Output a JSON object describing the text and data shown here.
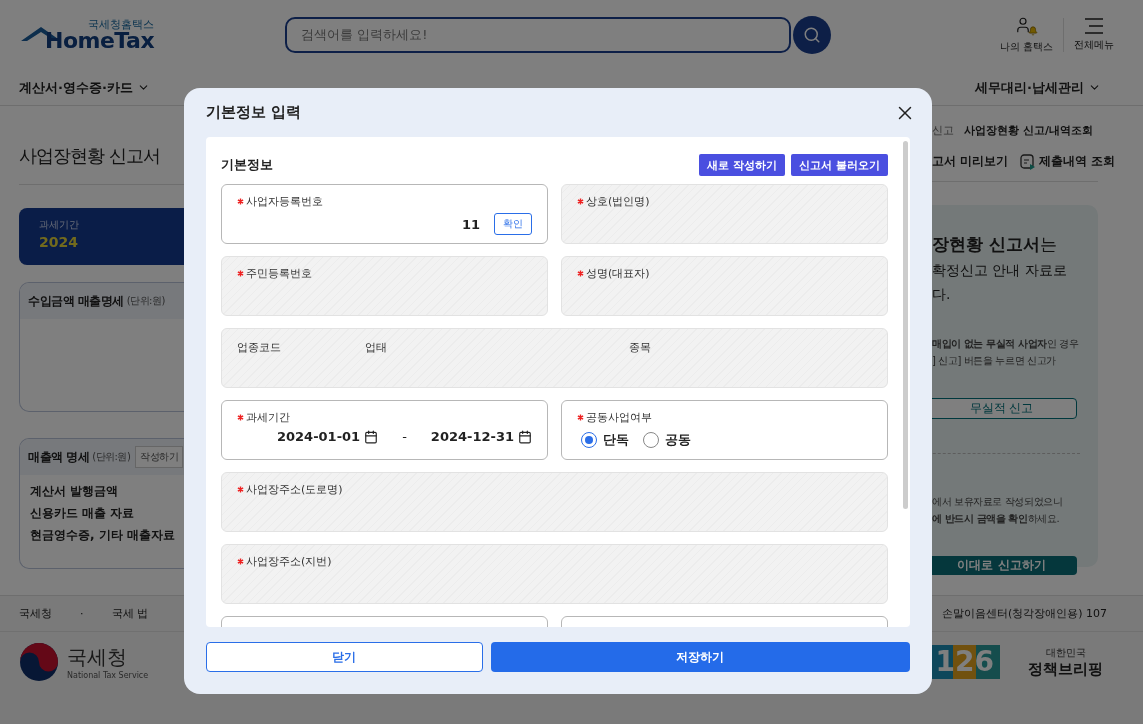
{
  "header": {
    "logo_caption": "국세청홈택스",
    "logo": "HomeTax",
    "search": {
      "placeholder": "검색어를 입력하세요!"
    },
    "links": [
      {
        "label": "나의 홈택스",
        "kind": "user"
      },
      {
        "label": "전체메뉴",
        "kind": "menu"
      }
    ]
  },
  "nav": [
    "계산서·영수증·카드",
    "세무대리·납세관리"
  ],
  "page": {
    "title": "사업장현황 신고서",
    "period": {
      "label": "과세기간",
      "value": "2024"
    },
    "income_card": {
      "title": "수입금액 매출명세",
      "unit": "(단위:원)"
    },
    "sales_card": {
      "title": "매출액 명세",
      "unit": "(단위:원)",
      "button": "작성하기",
      "rows": [
        "계산서 발행금액",
        "신용카드 매출 자료",
        "현금영수증, 기타 매출자료"
      ]
    }
  },
  "breadcrumb": [
    "신고",
    "사업장현황 신고/내역조회"
  ],
  "actions": [
    "고서 미리보기",
    "제출내역 조회"
  ],
  "guide": {
    "headline": "**장현황 신고서**는",
    "lines": [
      "확정신고 안내 자료로",
      "다."
    ],
    "notice": [
      "**매입이 없는 무실적 사업자**인 경우",
      "] 신고] 버튼을 누르면 신고가"
    ],
    "nil_button": "무실적 신고",
    "notice2": [
      "에서 보유자료로 작성되었으니",
      "**에 반드시 금액을 확인**하세요."
    ],
    "submit_button": "이대로 신고하기"
  },
  "footer": {
    "links": [
      "국세청",
      "·",
      "국세 법"
    ],
    "relay": "손말이음센터(청각장애인용) 107",
    "agency": "국세청",
    "agency_en": "National Tax Service",
    "hotline": "126",
    "briefing_caption": "대한민국",
    "briefing": "정책브리핑"
  },
  "modal": {
    "title": "기본정보 입력",
    "section": "기본정보",
    "section_buttons": [
      "새로 작성하기",
      "신고서 불러오기"
    ],
    "fields": [
      {
        "kind": "number",
        "label": "사업자등록번호",
        "required": true,
        "wide": false,
        "value": "11",
        "button": "확인"
      },
      {
        "kind": "readonly",
        "label": "상호(법인명)",
        "required": true,
        "wide": false
      },
      {
        "kind": "readonly",
        "label": "주민등록번호",
        "required": true,
        "wide": false
      },
      {
        "kind": "readonly",
        "label": "성명(대표자)",
        "required": true,
        "wide": false
      },
      {
        "kind": "triple",
        "labels": [
          "업종코드",
          "업태",
          "종목"
        ],
        "wide": true
      },
      {
        "kind": "period",
        "label": "과세기간",
        "required": true,
        "wide": false,
        "start": "2024-01-01",
        "separator": "-",
        "end": "2024-12-31"
      },
      {
        "kind": "radio",
        "label": "공동사업여부",
        "required": true,
        "wide": false,
        "options": [
          {
            "label": "단독",
            "selected": true
          },
          {
            "label": "공동",
            "selected": false
          }
        ]
      },
      {
        "kind": "readonly",
        "label": "사업장주소(도로명)",
        "required": true,
        "wide": true
      },
      {
        "kind": "readonly",
        "label": "사업장주소(지번)",
        "required": true,
        "wide": true
      },
      {
        "kind": "blank",
        "wide": false
      },
      {
        "kind": "blank",
        "wide": false
      }
    ],
    "buttons": [
      {
        "label": "닫기",
        "kind": "secondary"
      },
      {
        "label": "저장하기",
        "kind": "primary"
      }
    ]
  }
}
